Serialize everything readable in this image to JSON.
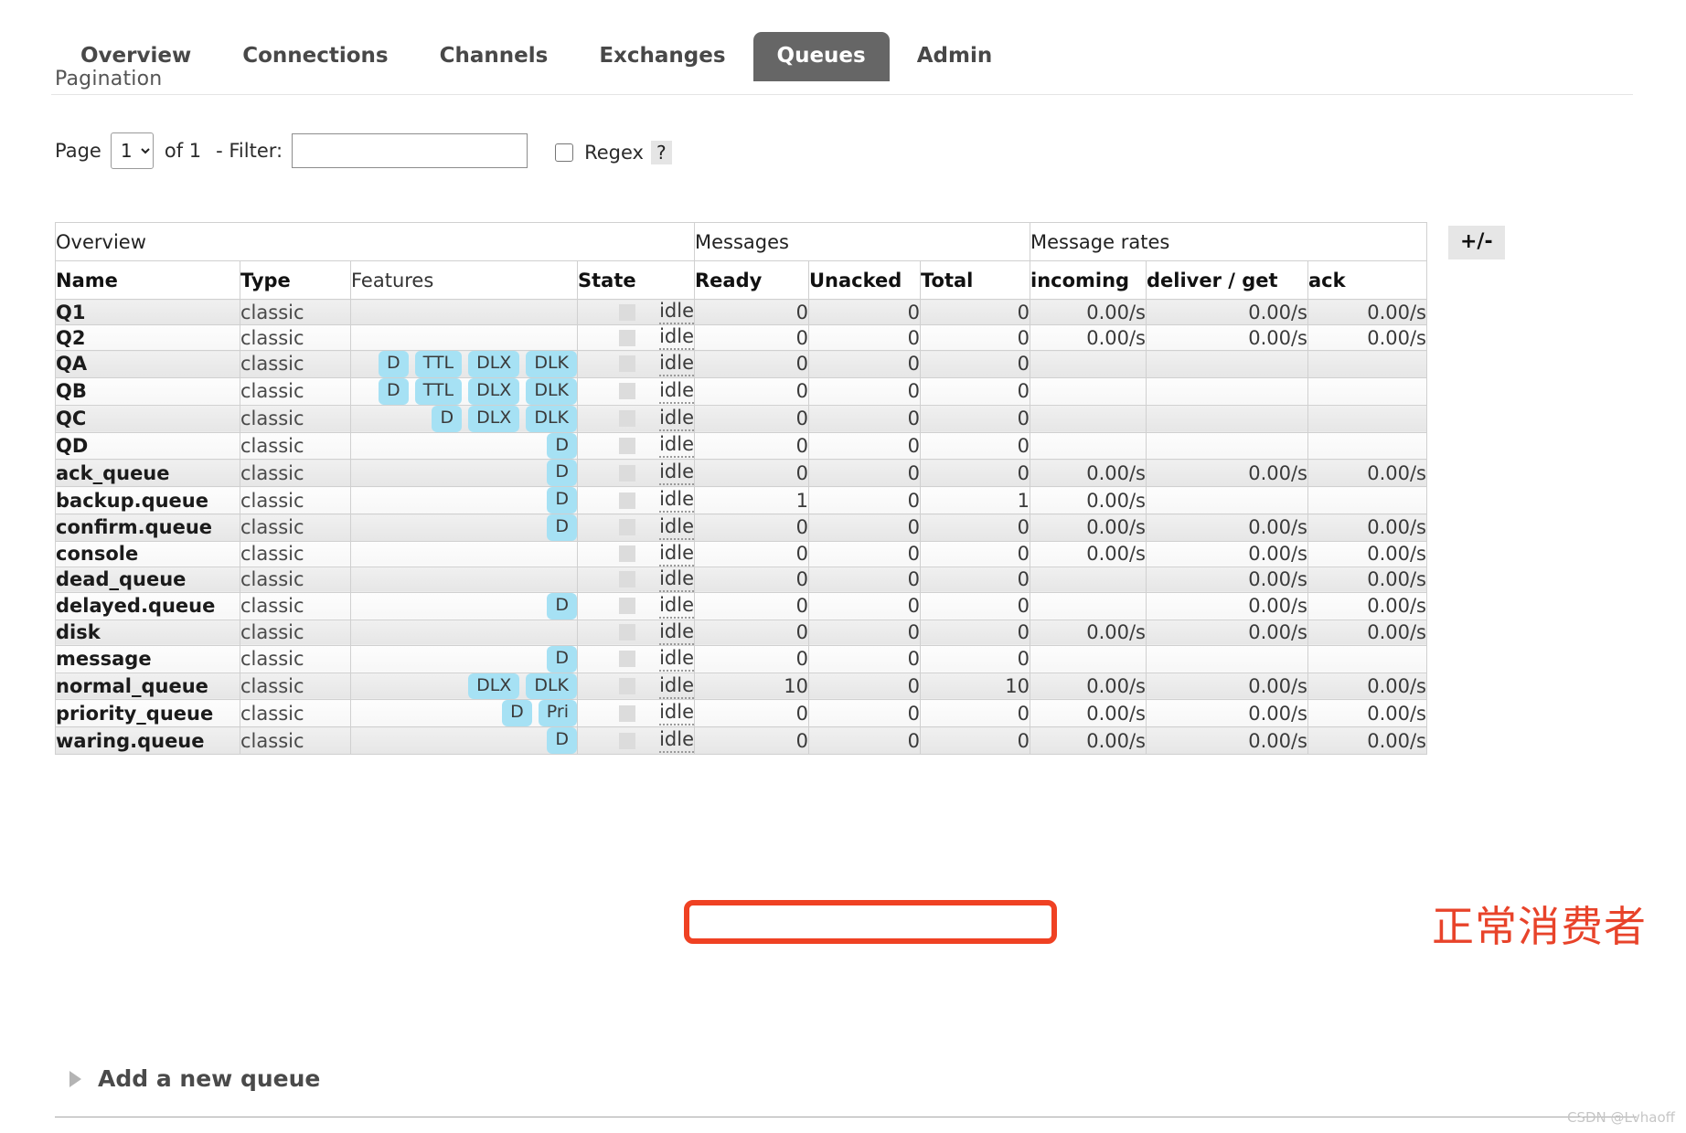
{
  "nav": {
    "tabs": [
      {
        "label": "Overview",
        "active": false
      },
      {
        "label": "Connections",
        "active": false
      },
      {
        "label": "Channels",
        "active": false
      },
      {
        "label": "Exchanges",
        "active": false
      },
      {
        "label": "Queues",
        "active": true
      },
      {
        "label": "Admin",
        "active": false
      }
    ]
  },
  "pagination": {
    "section_title": "Pagination",
    "page_label": "Page",
    "page_value": "1",
    "page_options": [
      "1"
    ],
    "of_label": "of 1",
    "filter_label": "- Filter:",
    "filter_value": "",
    "filter_placeholder": "",
    "regex_label": "Regex",
    "regex_checked": false,
    "help_label": "?"
  },
  "table": {
    "group_headers": [
      {
        "label": "Overview",
        "span": 4
      },
      {
        "label": "Messages",
        "span": 3
      },
      {
        "label": "Message rates",
        "span": 3
      }
    ],
    "columns": [
      {
        "label": "Name",
        "bold": true
      },
      {
        "label": "Type",
        "bold": true
      },
      {
        "label": "Features",
        "bold": false
      },
      {
        "label": "State",
        "bold": true
      },
      {
        "label": "Ready",
        "bold": true
      },
      {
        "label": "Unacked",
        "bold": true
      },
      {
        "label": "Total",
        "bold": true
      },
      {
        "label": "incoming",
        "bold": true
      },
      {
        "label": "deliver / get",
        "bold": true
      },
      {
        "label": "ack",
        "bold": true
      }
    ],
    "toggle_columns_label": "+/-",
    "rows": [
      {
        "name": "Q1",
        "type": "classic",
        "features": [],
        "state": "idle",
        "ready": "0",
        "unacked": "0",
        "total": "0",
        "incoming": "0.00/s",
        "deliver": "0.00/s",
        "ack": "0.00/s"
      },
      {
        "name": "Q2",
        "type": "classic",
        "features": [],
        "state": "idle",
        "ready": "0",
        "unacked": "0",
        "total": "0",
        "incoming": "0.00/s",
        "deliver": "0.00/s",
        "ack": "0.00/s"
      },
      {
        "name": "QA",
        "type": "classic",
        "features": [
          "D",
          "TTL",
          "DLX",
          "DLK"
        ],
        "state": "idle",
        "ready": "0",
        "unacked": "0",
        "total": "0",
        "incoming": "",
        "deliver": "",
        "ack": ""
      },
      {
        "name": "QB",
        "type": "classic",
        "features": [
          "D",
          "TTL",
          "DLX",
          "DLK"
        ],
        "state": "idle",
        "ready": "0",
        "unacked": "0",
        "total": "0",
        "incoming": "",
        "deliver": "",
        "ack": ""
      },
      {
        "name": "QC",
        "type": "classic",
        "features": [
          "D",
          "DLX",
          "DLK"
        ],
        "state": "idle",
        "ready": "0",
        "unacked": "0",
        "total": "0",
        "incoming": "",
        "deliver": "",
        "ack": ""
      },
      {
        "name": "QD",
        "type": "classic",
        "features": [
          "D"
        ],
        "state": "idle",
        "ready": "0",
        "unacked": "0",
        "total": "0",
        "incoming": "",
        "deliver": "",
        "ack": ""
      },
      {
        "name": "ack_queue",
        "type": "classic",
        "features": [
          "D"
        ],
        "state": "idle",
        "ready": "0",
        "unacked": "0",
        "total": "0",
        "incoming": "0.00/s",
        "deliver": "0.00/s",
        "ack": "0.00/s"
      },
      {
        "name": "backup.queue",
        "type": "classic",
        "features": [
          "D"
        ],
        "state": "idle",
        "ready": "1",
        "unacked": "0",
        "total": "1",
        "incoming": "0.00/s",
        "deliver": "",
        "ack": ""
      },
      {
        "name": "confirm.queue",
        "type": "classic",
        "features": [
          "D"
        ],
        "state": "idle",
        "ready": "0",
        "unacked": "0",
        "total": "0",
        "incoming": "0.00/s",
        "deliver": "0.00/s",
        "ack": "0.00/s"
      },
      {
        "name": "console",
        "type": "classic",
        "features": [],
        "state": "idle",
        "ready": "0",
        "unacked": "0",
        "total": "0",
        "incoming": "0.00/s",
        "deliver": "0.00/s",
        "ack": "0.00/s"
      },
      {
        "name": "dead_queue",
        "type": "classic",
        "features": [],
        "state": "idle",
        "ready": "0",
        "unacked": "0",
        "total": "0",
        "incoming": "",
        "deliver": "0.00/s",
        "ack": "0.00/s"
      },
      {
        "name": "delayed.queue",
        "type": "classic",
        "features": [
          "D"
        ],
        "state": "idle",
        "ready": "0",
        "unacked": "0",
        "total": "0",
        "incoming": "",
        "deliver": "0.00/s",
        "ack": "0.00/s"
      },
      {
        "name": "disk",
        "type": "classic",
        "features": [],
        "state": "idle",
        "ready": "0",
        "unacked": "0",
        "total": "0",
        "incoming": "0.00/s",
        "deliver": "0.00/s",
        "ack": "0.00/s"
      },
      {
        "name": "message",
        "type": "classic",
        "features": [
          "D"
        ],
        "state": "idle",
        "ready": "0",
        "unacked": "0",
        "total": "0",
        "incoming": "",
        "deliver": "",
        "ack": ""
      },
      {
        "name": "normal_queue",
        "type": "classic",
        "features": [
          "DLX",
          "DLK"
        ],
        "state": "idle",
        "ready": "10",
        "unacked": "0",
        "total": "10",
        "incoming": "0.00/s",
        "deliver": "0.00/s",
        "ack": "0.00/s"
      },
      {
        "name": "priority_queue",
        "type": "classic",
        "features": [
          "D",
          "Pri"
        ],
        "state": "idle",
        "ready": "0",
        "unacked": "0",
        "total": "0",
        "incoming": "0.00/s",
        "deliver": "0.00/s",
        "ack": "0.00/s"
      },
      {
        "name": "waring.queue",
        "type": "classic",
        "features": [
          "D"
        ],
        "state": "idle",
        "ready": "0",
        "unacked": "0",
        "total": "0",
        "incoming": "0.00/s",
        "deliver": "0.00/s",
        "ack": "0.00/s"
      }
    ]
  },
  "annotation": {
    "text": "正常消费者",
    "color": "#e8432a",
    "highlight_color": "#ef4123",
    "highlighted_row": "normal_queue"
  },
  "footer": {
    "add_queue_label": "Add a new queue",
    "watermark": "CSDN @Lvhaoff"
  },
  "colors": {
    "active_tab_bg": "#666666",
    "badge_bg": "#a6e1f4",
    "row_odd_bg": "#ececec",
    "row_even_bg": "#fafafa"
  }
}
